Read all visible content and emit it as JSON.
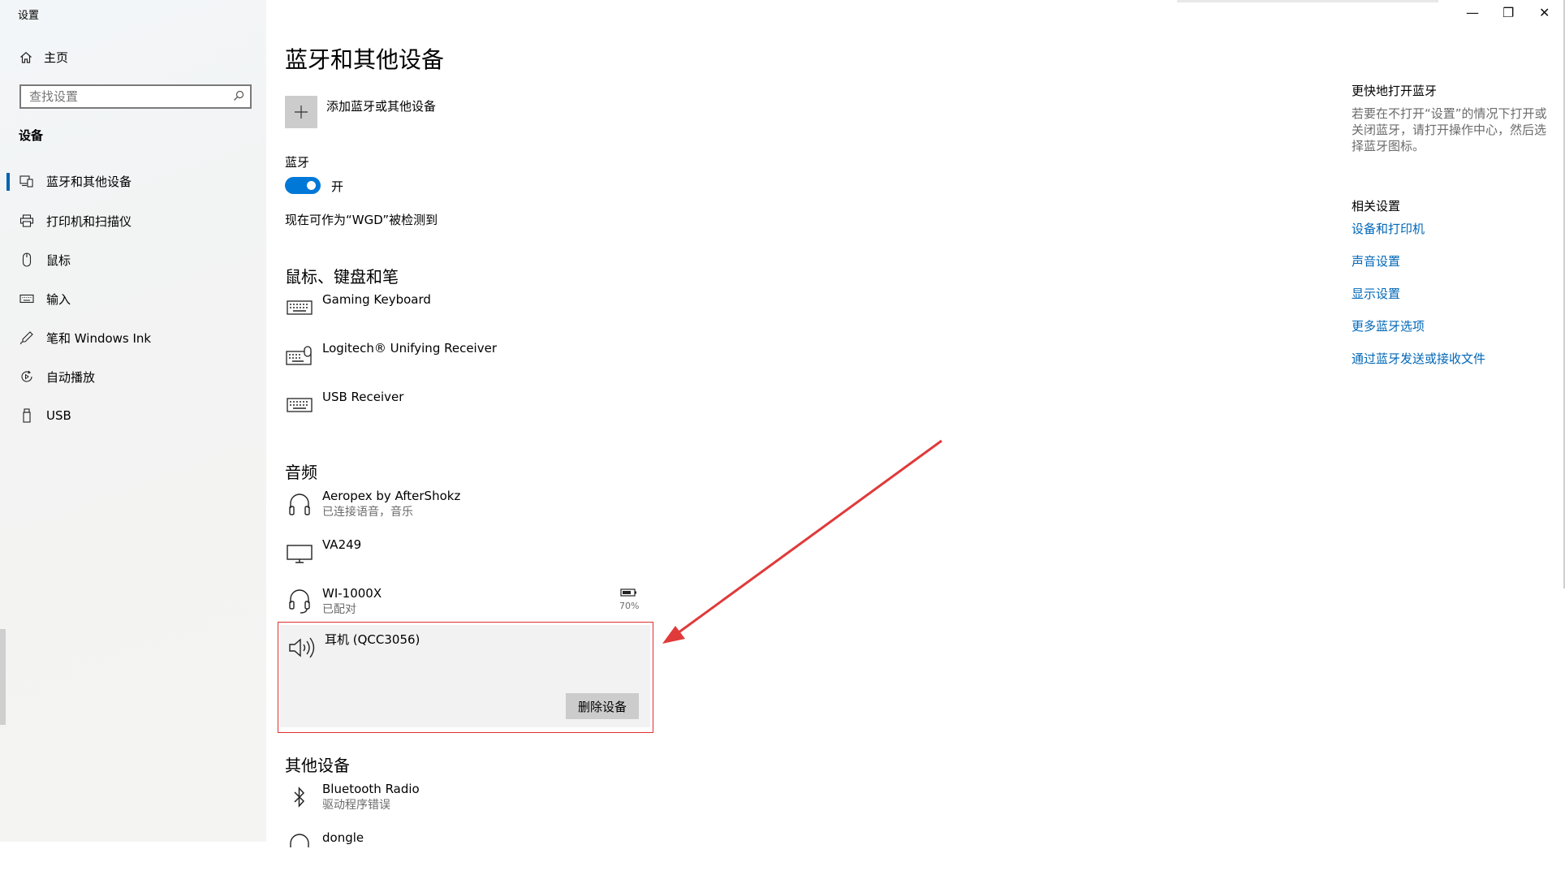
{
  "window": {
    "title": "设置",
    "minimize_glyph": "—",
    "restore_glyph": "❐",
    "close_glyph": "✕"
  },
  "sidebar": {
    "home_label": "主页",
    "search_placeholder": "查找设置",
    "section_label": "设备",
    "items": [
      {
        "label": "蓝牙和其他设备",
        "icon": "bluetooth-devices-icon",
        "active": true
      },
      {
        "label": "打印机和扫描仪",
        "icon": "printer-icon"
      },
      {
        "label": "鼠标",
        "icon": "mouse-icon"
      },
      {
        "label": "输入",
        "icon": "keyboard-icon"
      },
      {
        "label": "笔和 Windows Ink",
        "icon": "pen-icon"
      },
      {
        "label": "自动播放",
        "icon": "autoplay-icon"
      },
      {
        "label": "USB",
        "icon": "usb-icon"
      }
    ]
  },
  "main": {
    "title": "蓝牙和其他设备",
    "add_device_label": "添加蓝牙或其他设备",
    "bluetooth_label": "蓝牙",
    "bluetooth_state": "开",
    "discoverable_text": "现在可作为“WGD”被检测到",
    "sections": {
      "input": {
        "heading": "鼠标、键盘和笔",
        "devices": [
          {
            "name": "Gaming Keyboard",
            "icon": "keyboard-icon"
          },
          {
            "name": "Logitech® Unifying Receiver",
            "icon": "keyboard-mouse-icon"
          },
          {
            "name": "USB Receiver",
            "icon": "keyboard-icon"
          }
        ]
      },
      "audio": {
        "heading": "音频",
        "devices": [
          {
            "name": "Aeropex by AfterShokz",
            "status": "已连接语音，音乐",
            "icon": "headphones-icon"
          },
          {
            "name": "VA249",
            "icon": "monitor-icon"
          },
          {
            "name": "WI-1000X",
            "status": "已配对",
            "icon": "headset-icon",
            "battery": "70%"
          },
          {
            "name": "耳机 (QCC3056)",
            "icon": "speaker-icon",
            "selected": true,
            "action": "删除设备"
          }
        ]
      },
      "other": {
        "heading": "其他设备",
        "devices": [
          {
            "name": "Bluetooth Radio",
            "status": "驱动程序错误",
            "icon": "bluetooth-icon"
          },
          {
            "name": "dongle",
            "icon": "headset-icon"
          }
        ]
      }
    }
  },
  "right_panel": {
    "title": "更快地打开蓝牙",
    "description": "若要在不打开“设置”的情况下打开或关闭蓝牙，请打开操作中心，然后选择蓝牙图标。",
    "related_heading": "相关设置",
    "links": [
      "设备和打印机",
      "声音设置",
      "显示设置",
      "更多蓝牙选项",
      "通过蓝牙发送或接收文件"
    ]
  },
  "colors": {
    "accent": "#0078d7",
    "link": "#0067b8",
    "highlight_border": "#e02f2f",
    "arrow": "#e03a3a"
  }
}
